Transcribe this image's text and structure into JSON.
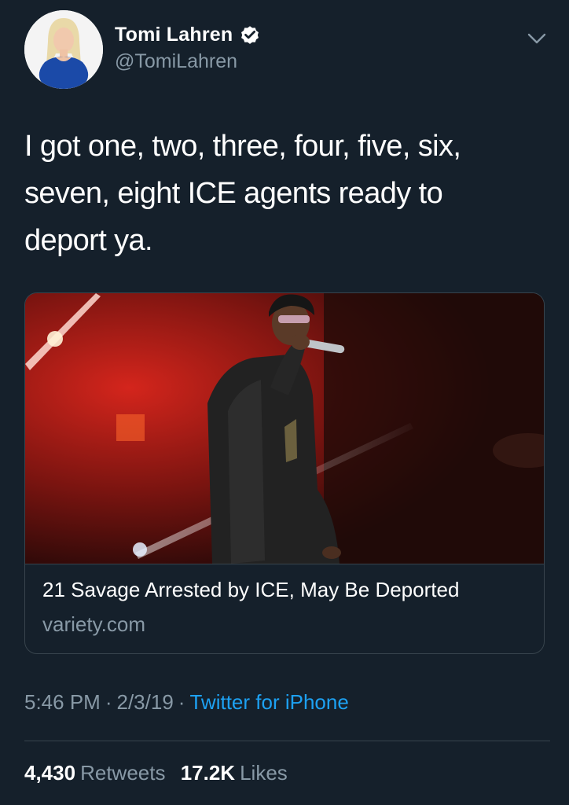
{
  "tweet": {
    "author": {
      "display_name": "Tomi Lahren",
      "handle": "@TomiLahren",
      "verified": true,
      "avatar_icon": "profile-photo"
    },
    "menu_icon": "chevron-down-icon",
    "text_lines": [
      "I got one, two, three, four, five, six,",
      "seven, eight ICE agents ready to",
      "deport ya."
    ],
    "card": {
      "image": "performer-on-stage-photo",
      "title": "21 Savage Arrested by ICE, May Be Deported",
      "domain": "variety.com"
    },
    "time": "5:46 PM",
    "date": "2/3/19",
    "separator": "·",
    "source": "Twitter for iPhone",
    "stats": {
      "retweets_count": "4,430",
      "retweets_label": "Retweets",
      "likes_count": "17.2K",
      "likes_label": "Likes"
    }
  },
  "colors": {
    "background": "#15202b",
    "primary_text": "#ffffff",
    "secondary_text": "#8899a6",
    "link": "#1da1f2",
    "border": "#38444d",
    "verified_badge": "#ffffff"
  }
}
